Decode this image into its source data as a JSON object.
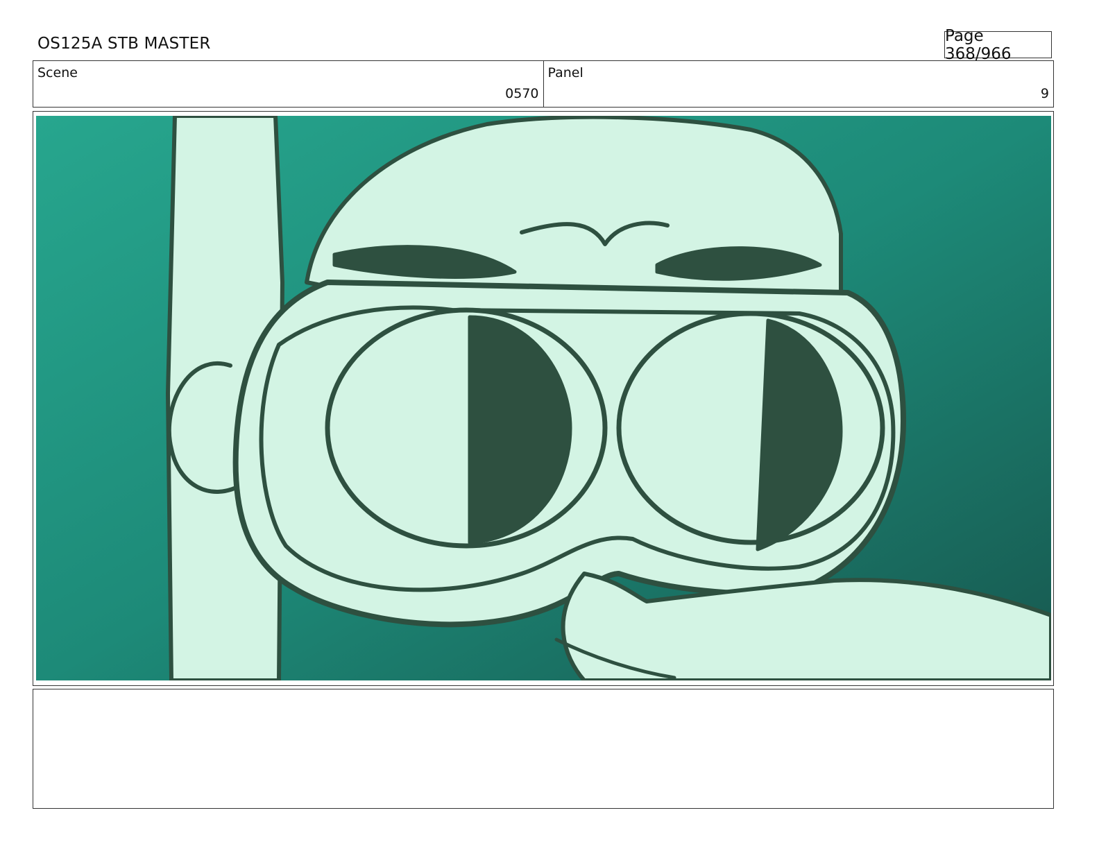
{
  "header": {
    "title": "OS125A STB MASTER",
    "page": "Page 368/966"
  },
  "scene": {
    "label": "Scene",
    "value": "0570"
  },
  "panel": {
    "label": "Panel",
    "value": "9"
  },
  "artwork": {
    "description_icon": "storyboard-drawing",
    "colors": {
      "water_dark": "#1a5f55",
      "water_light": "#2aa88f",
      "skin": "#d3f4e4",
      "ink": "#2e5040"
    }
  },
  "notes": {
    "text": ""
  }
}
